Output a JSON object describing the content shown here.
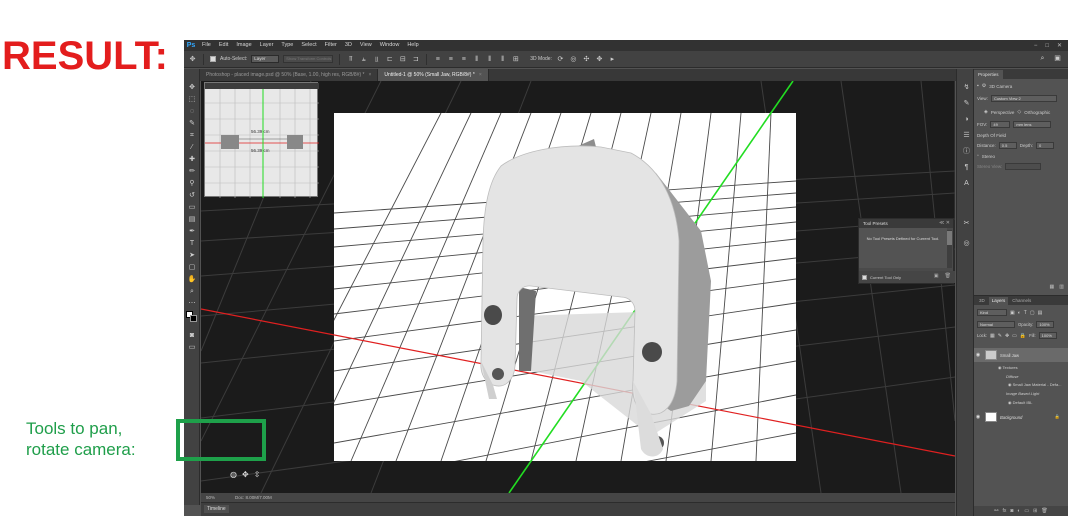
{
  "result_label": "RESULT:",
  "annotation": {
    "line1": "Tools to pan,",
    "line2": "rotate camera:",
    "color": "#1ea04a"
  },
  "menu": {
    "logo": "Ps",
    "items": [
      "File",
      "Edit",
      "Image",
      "Layer",
      "Type",
      "Select",
      "Filter",
      "3D",
      "View",
      "Window",
      "Help"
    ],
    "window_controls": [
      "−",
      "□",
      "✕"
    ]
  },
  "options_bar": {
    "auto_select_label": "Auto-Select:",
    "auto_select_value": "Layer",
    "transform_hint": "Show Transform Controls",
    "mode_label": "3D Mode:"
  },
  "doc_tabs": [
    {
      "label": "Photoshop - placed image.psd @ 50% (Base, 1.00, high res, RGB/8#) *",
      "active": false
    },
    {
      "label": "Untitled-1 @ 50% (Small Jaw, RGB/8#) *",
      "active": true
    }
  ],
  "navigator": {
    "dim_top": "56.39 cm",
    "dim_bottom": "56.39 cm"
  },
  "tool_presets": {
    "title": "Tool Presets",
    "message": "No Tool Presets Defined for Current Tool.",
    "current_tool_only": "Current Tool Only",
    "header_controls": "≪ ✕"
  },
  "properties": {
    "tab": "Properties",
    "section": "3D Camera",
    "view_label": "View:",
    "view_value": "Custom View 2",
    "perspective": "Perspective",
    "orthographic": "Orthographic",
    "fov_label": "FOV:",
    "fov_value": "49",
    "fov_unit": "mm lens",
    "dof_title": "Depth Of Field",
    "distance_label": "Distance:",
    "distance_value": "0.5",
    "depth_label": "Depth:",
    "depth_value": "0",
    "stereo_label": "Stereo",
    "stereo_view_label": "Stereo View:"
  },
  "layers": {
    "tabs": [
      "3D",
      "Layers",
      "Channels"
    ],
    "kind_label": "Kind",
    "blend_mode": "Normal",
    "opacity_label": "Opacity:",
    "opacity_value": "100%",
    "lock_label": "Lock:",
    "fill_label": "Fill:",
    "fill_value": "100%",
    "items": [
      {
        "name": "Small Jaw",
        "selected": true
      },
      {
        "name": "Background",
        "selected": false
      }
    ],
    "sub_items": [
      "Textures",
      "Diffuse",
      "Small Jaw Material - Defa...",
      "Image Based Light",
      "Default IBL"
    ]
  },
  "status": {
    "zoom": "50%",
    "doc": "Doc: 8.00M/7.00M"
  },
  "timeline_label": "Timeline",
  "colors": {
    "x_axis": "#e02020",
    "y_axis": "#22dd22",
    "canvas_bg": "#1b1b1b",
    "ps_panel": "#535353"
  }
}
